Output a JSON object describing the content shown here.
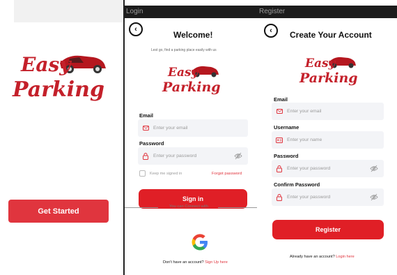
{
  "splash": {
    "logo_word1": "Easy",
    "logo_word2": "Parking",
    "cta_label": "Get Started"
  },
  "login": {
    "window_title": "Login",
    "heading": "Welcome!",
    "subtitle": "Lest go, find a parking place easily with us",
    "logo_word1": "Easy",
    "logo_word2": "Parking",
    "email_label": "Email",
    "email_placeholder": "Enter your email",
    "password_label": "Password",
    "password_placeholder": "Enter your password",
    "remember_label": "Keep me signed in",
    "forgot_label": "Forgot password",
    "signin_label": "Sign in",
    "connect_text": "You can Connect with",
    "footer_text": "Don't have an account?",
    "footer_link": "Sign Up here"
  },
  "register": {
    "window_title": "Register",
    "heading": "Create Your Account",
    "logo_word1": "Easy",
    "logo_word2": "Parking",
    "email_label": "Email",
    "email_placeholder": "Enter your email",
    "username_label": "Username",
    "username_placeholder": "Enter your name",
    "password_label": "Password",
    "password_placeholder": "Enter your password",
    "confirm_label": "Confirm Password",
    "confirm_placeholder": "Enter your password",
    "register_label": "Register",
    "footer_text": "Already have an account?",
    "footer_link": "Login here"
  },
  "colors": {
    "brand_red": "#e01f26",
    "logo_red": "#c4202a",
    "field_bg": "#f3f4f7"
  },
  "icons": [
    "back-arrow-icon",
    "mail-icon",
    "lock-icon",
    "eye-off-icon",
    "id-card-icon",
    "google-icon",
    "car-icon"
  ]
}
